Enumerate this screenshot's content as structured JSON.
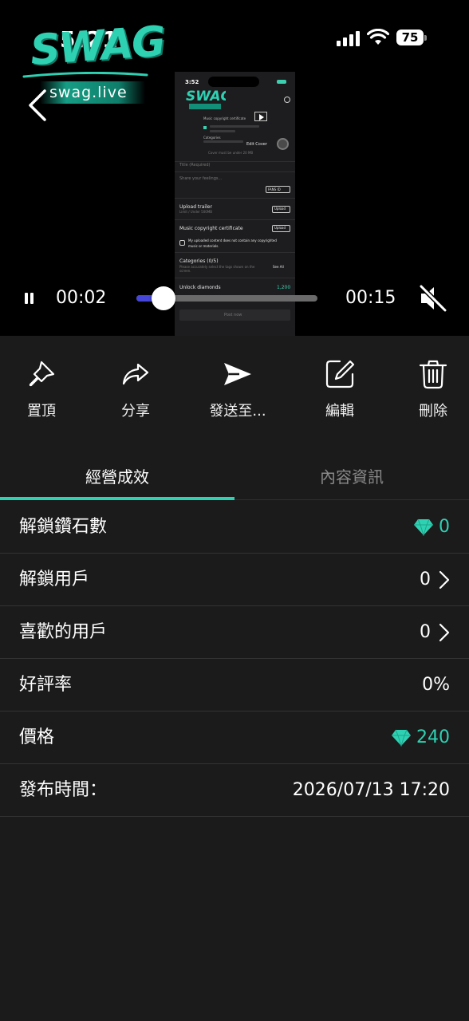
{
  "status_bar": {
    "time": "5:21",
    "battery": "75"
  },
  "logo": {
    "wordmark": "SWAG",
    "url": "swag.live"
  },
  "player": {
    "current_time": "00:02",
    "total_time": "00:15",
    "progress": 0.15,
    "muted": true
  },
  "video_preview": {
    "time": "3:52",
    "music_copyright": "Music copyright certificate",
    "categories": "Categories",
    "edit_cover": "Edit Cover",
    "cover_hint": "Cover must be under 20 MB",
    "title_field": "Title (Required)",
    "feelings_field": "Share your feelings...",
    "fans_id": "FANS ID",
    "upload_trailer": "Upload trailer",
    "trailer_hint": "Limit / Under 500MB",
    "upload": "Upload",
    "music_cert": "Music copyright certificate",
    "declaration": "My uploaded content does not contain any copyrighted music or materials.",
    "categories_count": "Categories (0/5)",
    "categories_hint": "Please accurately select the tags shown on the screen.",
    "see_all": "See All",
    "unlock_diamonds": "Unlock diamonds",
    "unlock_value": "1,200",
    "post_now": "Post now"
  },
  "actions": [
    {
      "id": "pin",
      "label": "置頂",
      "icon": "pin-icon"
    },
    {
      "id": "share",
      "label": "分享",
      "icon": "share-icon"
    },
    {
      "id": "send",
      "label": "發送至...",
      "icon": "send-icon"
    },
    {
      "id": "edit",
      "label": "編輯",
      "icon": "edit-icon"
    },
    {
      "id": "delete",
      "label": "刪除",
      "icon": "trash-icon"
    }
  ],
  "tabs": [
    {
      "label": "經營成效",
      "active": true
    },
    {
      "label": "內容資訊",
      "active": false
    }
  ],
  "stats": {
    "unlock_diamonds": {
      "label": "解鎖鑽石數",
      "value": "0"
    },
    "unlock_users": {
      "label": "解鎖用戶",
      "value": "0"
    },
    "liked_users": {
      "label": "喜歡的用戶",
      "value": "0"
    },
    "rating": {
      "label": "好評率",
      "value": "0%"
    },
    "price": {
      "label": "價格",
      "value": "240"
    },
    "published": {
      "label": "發布時間：",
      "value": "2026/07/13 17:20"
    }
  },
  "colors": {
    "accent": "#2fd1b3",
    "progress": "#4646d8",
    "background": "#1b1b1b",
    "divider": "#333333"
  }
}
